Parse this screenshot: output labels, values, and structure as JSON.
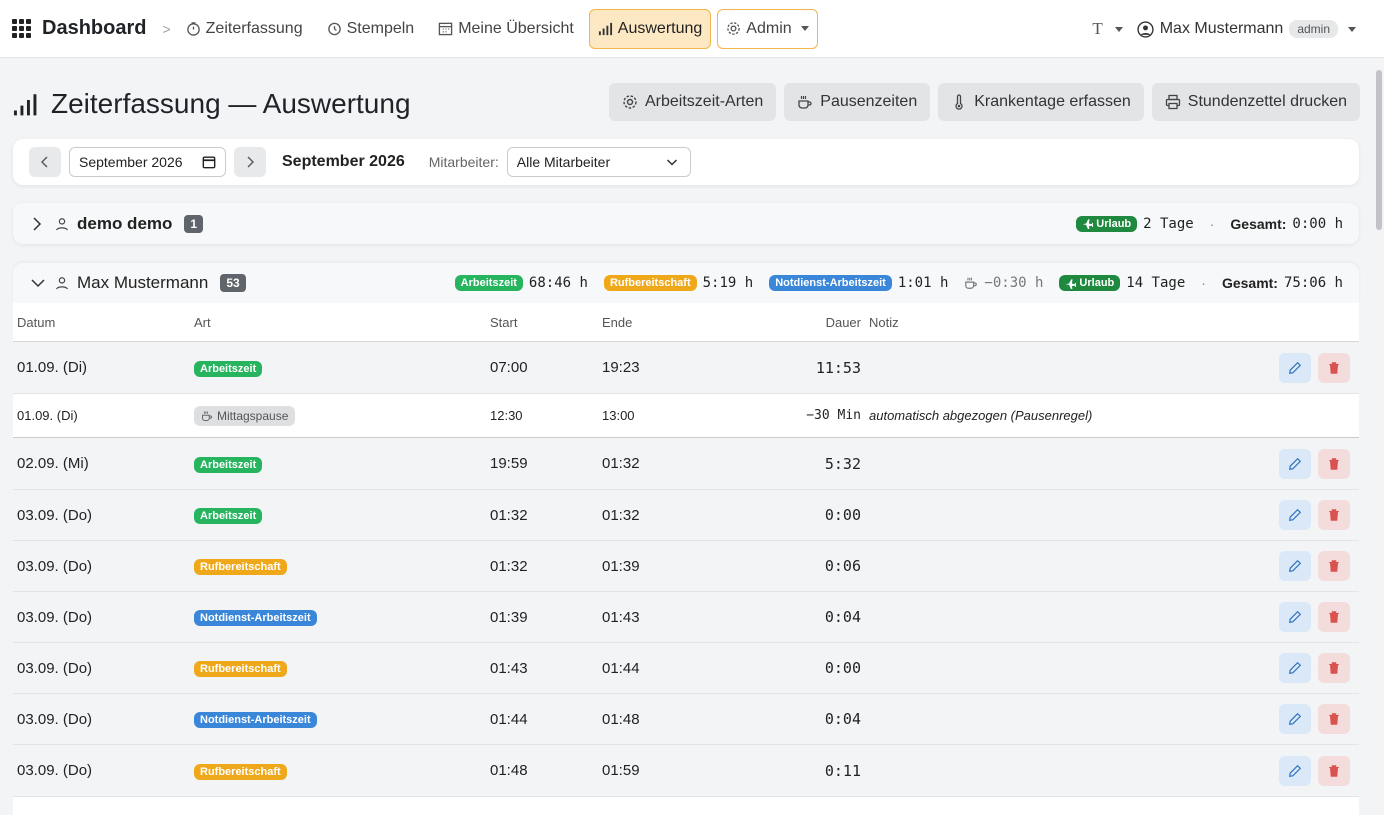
{
  "nav": {
    "brand": "Dashboard",
    "items": [
      {
        "label": "Zeiterfassung"
      },
      {
        "label": "Stempeln"
      },
      {
        "label": "Meine Übersicht"
      },
      {
        "label": "Auswertung"
      },
      {
        "label": "Admin"
      }
    ],
    "theme_label": "T",
    "user_name": "Max Mustermann",
    "user_role": "admin"
  },
  "page": {
    "title": "Zeiterfassung — Auswertung",
    "actions": [
      {
        "label": "Arbeitszeit-Arten",
        "icon": "gear-icon"
      },
      {
        "label": "Pausenzeiten",
        "icon": "coffee-icon"
      },
      {
        "label": "Krankentage erfassen",
        "icon": "thermometer-icon"
      },
      {
        "label": "Stundenzettel drucken",
        "icon": "printer-icon"
      }
    ]
  },
  "filter": {
    "month_value": "September 2026",
    "month_label": "September 2026",
    "employee_label": "Mitarbeiter:",
    "employee_value": "Alle Mitarbeiter"
  },
  "colors": {
    "arbeitszeit": "#27b45f",
    "rufbereitschaft": "#f0a81b",
    "notdienst": "#3a86d8",
    "urlaub": "#1f8a3f",
    "active_nav": "#fde8c4"
  },
  "employees": [
    {
      "name": "demo demo",
      "count": "1",
      "urlaub_label": "Urlaub",
      "urlaub_value": "2 Tage",
      "dot": "·",
      "total_label": "Gesamt:",
      "total_value": "0:00 h"
    },
    {
      "name": "Max Mustermann",
      "count": "53",
      "sums": {
        "arbeitszeit_label": "Arbeitszeit",
        "arbeitszeit_value": "68:46 h",
        "ruf_label": "Rufbereitschaft",
        "ruf_value": "5:19 h",
        "notdienst_label": "Notdienst-Arbeitszeit",
        "notdienst_value": "1:01 h",
        "pause_value": "−0:30 h",
        "urlaub_label": "Urlaub",
        "urlaub_value": "14 Tage",
        "dot": "·",
        "total_label": "Gesamt:",
        "total_value": "75:06 h"
      }
    }
  ],
  "table": {
    "headers": {
      "date": "Datum",
      "type": "Art",
      "start": "Start",
      "end": "Ende",
      "duration": "Dauer",
      "note": "Notiz"
    },
    "rows": [
      {
        "date": "01.09. (Di)",
        "type": "Arbeitszeit",
        "start": "07:00",
        "end": "19:23",
        "duration": "11:53"
      },
      {
        "date": "01.09. (Di)",
        "type": "Mittagspause",
        "start": "12:30",
        "end": "13:00",
        "duration": "−30 Min",
        "note": "automatisch abgezogen (Pausenregel)"
      },
      {
        "date": "02.09. (Mi)",
        "type": "Arbeitszeit",
        "start": "19:59",
        "end": "01:32",
        "duration": "5:32"
      },
      {
        "date": "03.09. (Do)",
        "type": "Arbeitszeit",
        "start": "01:32",
        "end": "01:32",
        "duration": "0:00"
      },
      {
        "date": "03.09. (Do)",
        "type": "Rufbereitschaft",
        "start": "01:32",
        "end": "01:39",
        "duration": "0:06"
      },
      {
        "date": "03.09. (Do)",
        "type": "Notdienst-Arbeitszeit",
        "start": "01:39",
        "end": "01:43",
        "duration": "0:04"
      },
      {
        "date": "03.09. (Do)",
        "type": "Rufbereitschaft",
        "start": "01:43",
        "end": "01:44",
        "duration": "0:00"
      },
      {
        "date": "03.09. (Do)",
        "type": "Notdienst-Arbeitszeit",
        "start": "01:44",
        "end": "01:48",
        "duration": "0:04"
      },
      {
        "date": "03.09. (Do)",
        "type": "Rufbereitschaft",
        "start": "01:48",
        "end": "01:59",
        "duration": "0:11"
      }
    ]
  }
}
